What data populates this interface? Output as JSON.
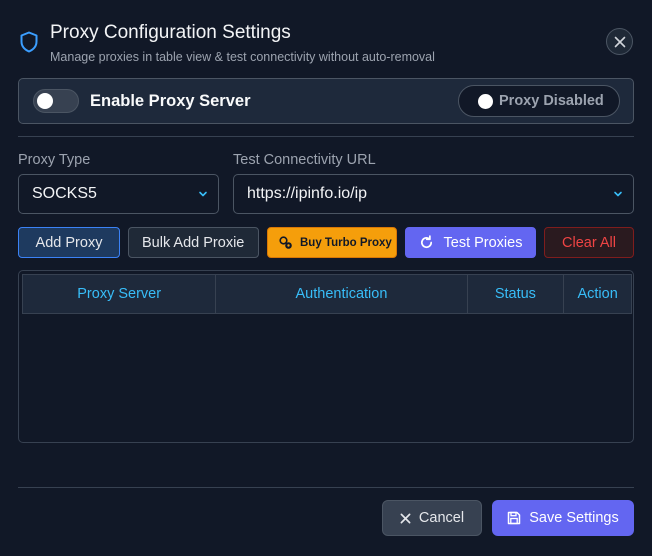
{
  "header": {
    "title": "Proxy Configuration Settings",
    "subtitle": "Manage proxies in table view & test connectivity without auto-removal",
    "icon": "shield-icon",
    "close_icon": "close-icon"
  },
  "enable_panel": {
    "label": "Enable Proxy Server",
    "enabled": false,
    "status_text": "Proxy Disabled"
  },
  "proxy_type": {
    "label": "Proxy Type",
    "value": "SOCKS5"
  },
  "test_url": {
    "label": "Test Connectivity URL",
    "value": "https://ipinfo.io/ip"
  },
  "actions": {
    "add_proxy": "Add Proxy",
    "bulk_add": "Bulk Add Proxie",
    "buy_turbo": "Buy Turbo Proxy",
    "test_proxies": "Test Proxies",
    "clear_all": "Clear All"
  },
  "table": {
    "columns": [
      "Proxy Server",
      "Authentication",
      "Status",
      "Action"
    ],
    "rows": []
  },
  "footer": {
    "cancel": "Cancel",
    "save": "Save Settings"
  },
  "colors": {
    "background": "#111827",
    "panel": "#1e293b",
    "accent": "#6366f1",
    "header_text": "#38bdf8",
    "turbo": "#f59e0b",
    "danger": "#ef4444"
  }
}
